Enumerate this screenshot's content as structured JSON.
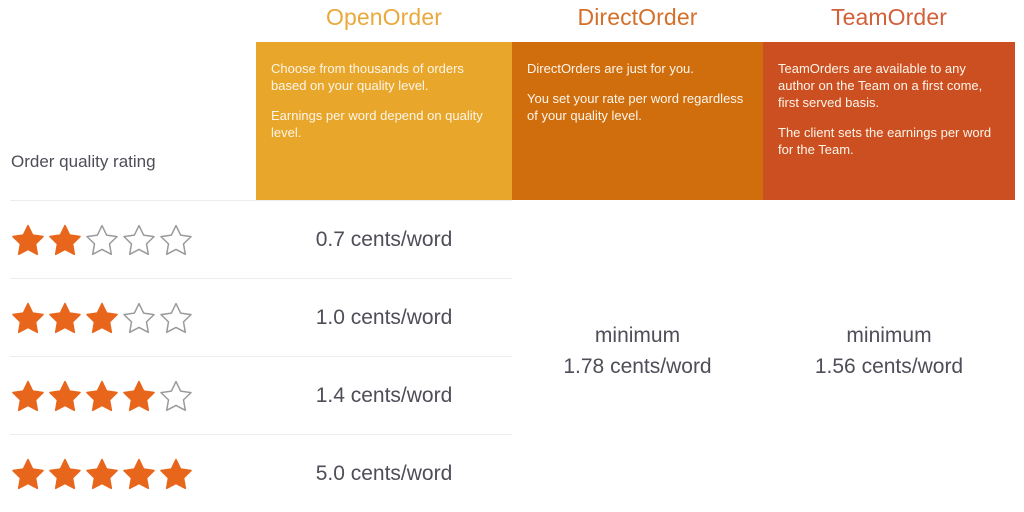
{
  "colors": {
    "open_header_text": "#eaa93d",
    "direct_header_text": "#d4702a",
    "team_header_text": "#d4603a",
    "open_panel_bg": "#e8a72a",
    "direct_panel_bg": "#d06e0e",
    "team_panel_bg": "#cc4f21",
    "star_filled": "#e8661c",
    "star_empty_outline": "#9a9a9a",
    "body_text": "#4e4e58",
    "divider": "#ececec"
  },
  "columns": {
    "rating": {
      "label": "Order quality rating"
    },
    "open_order": {
      "title": "OpenOrder",
      "description": [
        "Choose from thousands of orders based on your quality level.",
        "Earnings per word depend on quality level."
      ]
    },
    "direct_order": {
      "title": "DirectOrder",
      "description": [
        "DirectOrders are just for you.",
        "You set your rate per word regardless of your quality level."
      ],
      "minimum_label": "minimum",
      "minimum_value": "1.78 cents/word"
    },
    "team_order": {
      "title": "TeamOrder",
      "description": [
        "TeamOrders are available to any author on the Team on a first come, first served basis.",
        "The client sets the earnings per word for the Team."
      ],
      "minimum_label": "minimum",
      "minimum_value": "1.56 cents/word"
    }
  },
  "rows": [
    {
      "stars_filled": 2,
      "stars_total": 5,
      "rate": "0.7 cents/word"
    },
    {
      "stars_filled": 3,
      "stars_total": 5,
      "rate": "1.0 cents/word"
    },
    {
      "stars_filled": 4,
      "stars_total": 5,
      "rate": "1.4 cents/word"
    },
    {
      "stars_filled": 5,
      "stars_total": 5,
      "rate": "5.0 cents/word"
    }
  ],
  "icons": {
    "star_filled": "star-filled-icon",
    "star_empty": "star-outline-icon"
  }
}
